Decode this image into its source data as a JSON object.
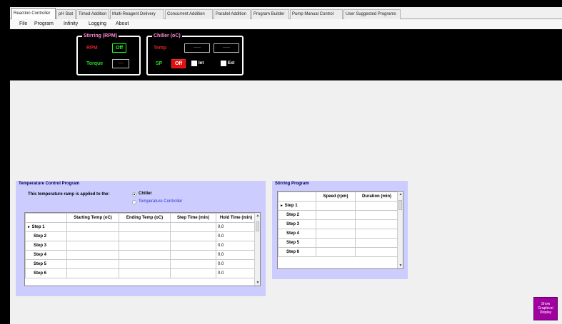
{
  "tabs": [
    "Reaction Controller",
    "pH Stat",
    "Timed Addition",
    "Multi-Reagent Delivery",
    "Concurrent Addition",
    "Parallel Addition",
    "Program Builder",
    "Pump Manual Control",
    "User Suggested Programs"
  ],
  "active_tab": "Reaction Controller",
  "menu": [
    "File",
    "Program",
    "Infinity",
    "Logging",
    "About"
  ],
  "stirring": {
    "title": "Stirring (RPM)",
    "rpm_label": "RPM",
    "rpm_button": "Off",
    "torque_label": "Torque",
    "torque_value": "----"
  },
  "chiller": {
    "title": "Chiller (oC)",
    "temp_label": "Temp",
    "temp_value_1": "-----",
    "temp_value_2": "-----",
    "sp_label": "SP",
    "sp_button": "Off",
    "int_label": "Int",
    "ext_label": "Ext"
  },
  "temp_program": {
    "title": "Temperature Control Program",
    "ramp_text": "This temperature ramp is applied to the:",
    "option_chiller": "Chiller",
    "option_controller": "Temperature Controller",
    "columns": [
      "",
      "Starting Temp (oC)",
      "Ending Temp (oC)",
      "Step Time (min)",
      "Hold Time (min)"
    ],
    "rows": [
      {
        "step": "Step 1",
        "start": "",
        "end": "",
        "time": "",
        "hold": "0.0"
      },
      {
        "step": "Step 2",
        "start": "",
        "end": "",
        "time": "",
        "hold": "0.0"
      },
      {
        "step": "Step 3",
        "start": "",
        "end": "",
        "time": "",
        "hold": "0.0"
      },
      {
        "step": "Step 4",
        "start": "",
        "end": "",
        "time": "",
        "hold": "0.0"
      },
      {
        "step": "Step 5",
        "start": "",
        "end": "",
        "time": "",
        "hold": "0.0"
      },
      {
        "step": "Step 6",
        "start": "",
        "end": "",
        "time": "",
        "hold": "0.0"
      }
    ]
  },
  "stirring_program": {
    "title": "Stirring Program",
    "columns": [
      "",
      "Speed (rpm)",
      "Duration (min)"
    ],
    "rows": [
      {
        "step": "Step 1",
        "speed": "",
        "duration": ""
      },
      {
        "step": "Step 2",
        "speed": "",
        "duration": ""
      },
      {
        "step": "Step 3",
        "speed": "",
        "duration": ""
      },
      {
        "step": "Step 4",
        "speed": "",
        "duration": ""
      },
      {
        "step": "Step 5",
        "speed": "",
        "duration": ""
      },
      {
        "step": "Step 6",
        "speed": "",
        "duration": ""
      }
    ]
  },
  "show_graphical": [
    "Show",
    "Graphical",
    "Display"
  ],
  "colors": {
    "panel_bg": "#ccccff",
    "show_button": "#a000a0",
    "off_red": "#e01010",
    "label_green": "#22dd22",
    "label_red": "#e02020"
  }
}
